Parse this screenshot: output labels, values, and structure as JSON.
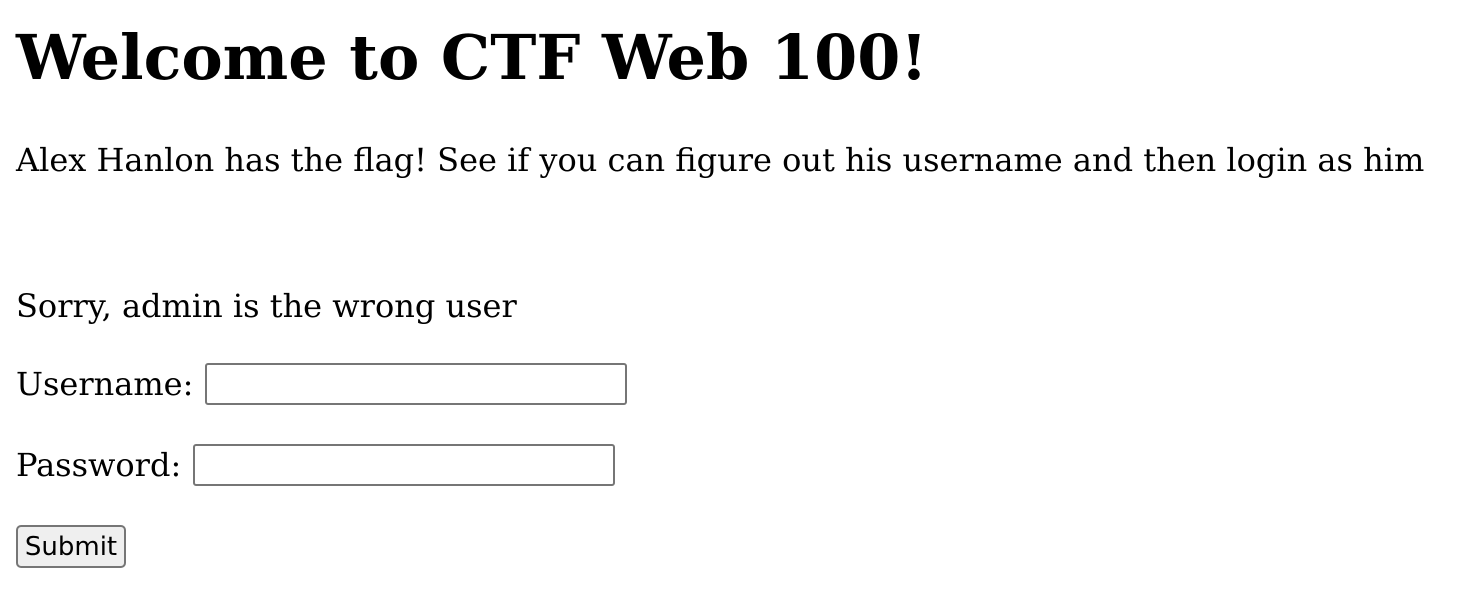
{
  "page": {
    "title": "Welcome to CTF Web 100!",
    "intro": "Alex Hanlon has the flag! See if you can figure out his username and then login as him"
  },
  "form": {
    "error_message": "Sorry, admin is the wrong user",
    "username_label": "Username:",
    "username_value": "",
    "password_label": "Password:",
    "password_value": "",
    "submit_label": "Submit"
  }
}
